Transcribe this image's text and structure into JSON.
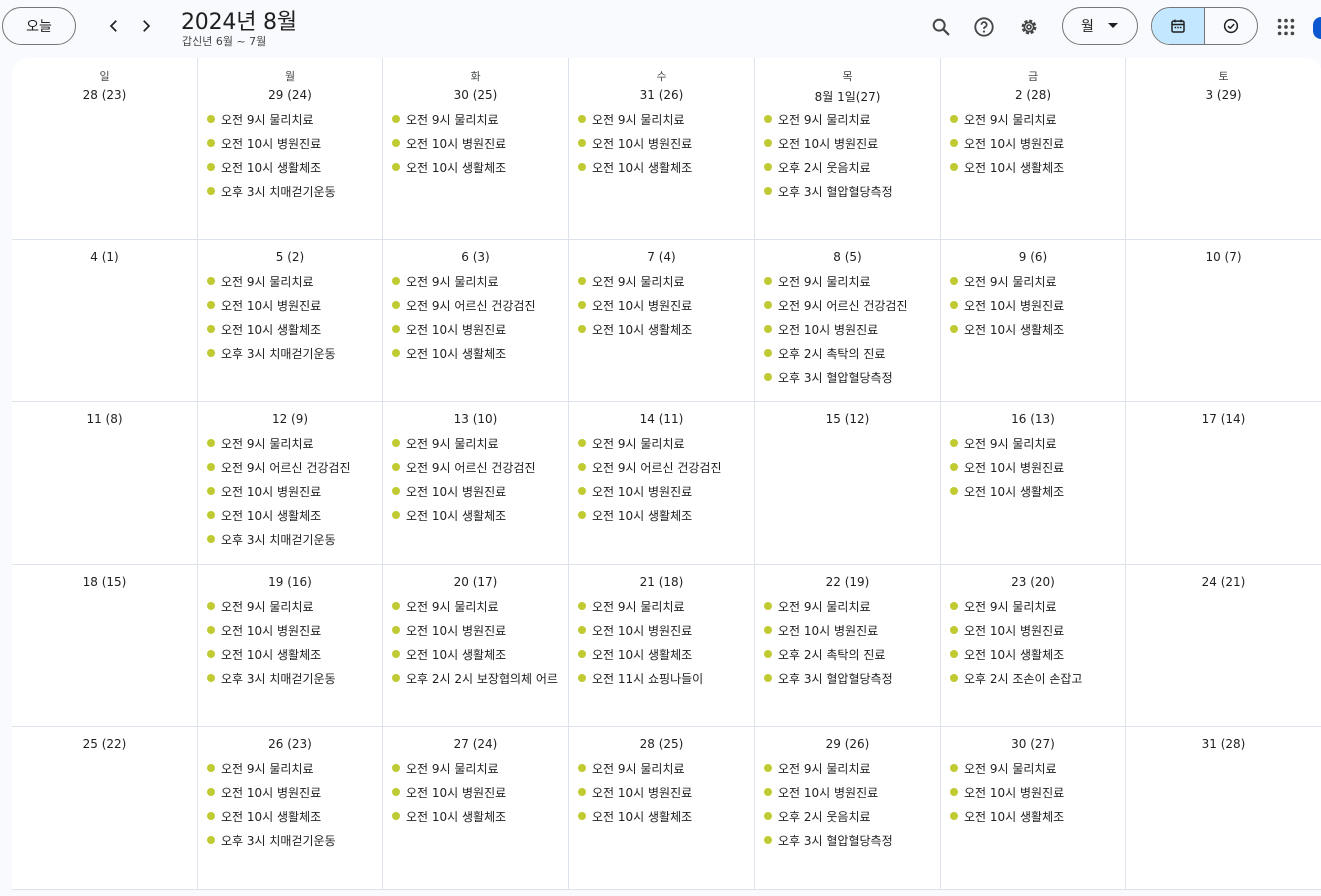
{
  "header": {
    "today_label": "오늘",
    "title": "2024년 8월",
    "subtitle": "갑신년 6월 ~ 7월",
    "view_label": "월",
    "icons": {
      "prev": "chevron-left-icon",
      "next": "chevron-right-icon",
      "search": "search-icon",
      "help": "help-icon",
      "settings": "gear-icon",
      "dropdown": "caret-down-icon",
      "calendar": "calendar-icon",
      "tasks": "task-check-icon",
      "apps": "apps-grid-icon"
    },
    "accent_color": "#c2e7ff",
    "event_dot_color": "#c0ca33"
  },
  "weekdays": [
    "일",
    "월",
    "화",
    "수",
    "목",
    "금",
    "토"
  ],
  "weeks": [
    [
      {
        "date": "28 (23)",
        "events": []
      },
      {
        "date": "29 (24)",
        "events": [
          "오전 9시 물리치료",
          "오전 10시 병원진료",
          "오전 10시 생활체조",
          "오후 3시 치매걷기운동"
        ]
      },
      {
        "date": "30 (25)",
        "events": [
          "오전 9시 물리치료",
          "오전 10시 병원진료",
          "오전 10시 생활체조"
        ]
      },
      {
        "date": "31 (26)",
        "events": [
          "오전 9시 물리치료",
          "오전 10시 병원진료",
          "오전 10시 생활체조"
        ]
      },
      {
        "date": "8월 1일(27)",
        "events": [
          "오전 9시 물리치료",
          "오전 10시 병원진료",
          "오후 2시 웃음치료",
          "오후 3시 혈압혈당측정"
        ]
      },
      {
        "date": "2 (28)",
        "events": [
          "오전 9시 물리치료",
          "오전 10시 병원진료",
          "오전 10시 생활체조"
        ]
      },
      {
        "date": "3 (29)",
        "events": []
      }
    ],
    [
      {
        "date": "4 (1)",
        "events": []
      },
      {
        "date": "5 (2)",
        "events": [
          "오전 9시 물리치료",
          "오전 10시 병원진료",
          "오전 10시 생활체조",
          "오후 3시 치매걷기운동"
        ]
      },
      {
        "date": "6 (3)",
        "events": [
          "오전 9시 물리치료",
          "오전 9시 어르신 건강검진",
          "오전 10시 병원진료",
          "오전 10시 생활체조"
        ]
      },
      {
        "date": "7 (4)",
        "events": [
          "오전 9시 물리치료",
          "오전 10시 병원진료",
          "오전 10시 생활체조"
        ]
      },
      {
        "date": "8 (5)",
        "events": [
          "오전 9시 물리치료",
          "오전 9시 어르신 건강검진",
          "오전 10시 병원진료",
          "오후 2시 촉탁의 진료",
          "오후 3시 혈압혈당측정"
        ]
      },
      {
        "date": "9 (6)",
        "events": [
          "오전 9시 물리치료",
          "오전 10시 병원진료",
          "오전 10시 생활체조"
        ]
      },
      {
        "date": "10 (7)",
        "events": []
      }
    ],
    [
      {
        "date": "11 (8)",
        "events": []
      },
      {
        "date": "12 (9)",
        "events": [
          "오전 9시 물리치료",
          "오전 9시 어르신 건강검진",
          "오전 10시 병원진료",
          "오전 10시 생활체조",
          "오후 3시 치매걷기운동"
        ]
      },
      {
        "date": "13 (10)",
        "events": [
          "오전 9시 물리치료",
          "오전 9시 어르신 건강검진",
          "오전 10시 병원진료",
          "오전 10시 생활체조"
        ]
      },
      {
        "date": "14 (11)",
        "events": [
          "오전 9시 물리치료",
          "오전 9시 어르신 건강검진",
          "오전 10시 병원진료",
          "오전 10시 생활체조"
        ]
      },
      {
        "date": "15 (12)",
        "events": []
      },
      {
        "date": "16 (13)",
        "events": [
          "오전 9시 물리치료",
          "오전 10시 병원진료",
          "오전 10시 생활체조"
        ]
      },
      {
        "date": "17 (14)",
        "events": []
      }
    ],
    [
      {
        "date": "18 (15)",
        "events": []
      },
      {
        "date": "19 (16)",
        "events": [
          "오전 9시 물리치료",
          "오전 10시 병원진료",
          "오전 10시 생활체조",
          "오후 3시 치매걷기운동"
        ]
      },
      {
        "date": "20 (17)",
        "events": [
          "오전 9시 물리치료",
          "오전 10시 병원진료",
          "오전 10시 생활체조",
          "오후 2시 2시 보장협의체 어르"
        ]
      },
      {
        "date": "21 (18)",
        "events": [
          "오전 9시 물리치료",
          "오전 10시 병원진료",
          "오전 10시 생활체조",
          "오전 11시 쇼핑나들이"
        ]
      },
      {
        "date": "22 (19)",
        "events": [
          "오전 9시 물리치료",
          "오전 10시 병원진료",
          "오후 2시 촉탁의 진료",
          "오후 3시 혈압혈당측정"
        ]
      },
      {
        "date": "23 (20)",
        "events": [
          "오전 9시 물리치료",
          "오전 10시 병원진료",
          "오전 10시 생활체조",
          "오후 2시 조손이 손잡고"
        ]
      },
      {
        "date": "24 (21)",
        "events": []
      }
    ],
    [
      {
        "date": "25 (22)",
        "events": []
      },
      {
        "date": "26 (23)",
        "events": [
          "오전 9시 물리치료",
          "오전 10시 병원진료",
          "오전 10시 생활체조",
          "오후 3시 치매걷기운동"
        ]
      },
      {
        "date": "27 (24)",
        "events": [
          "오전 9시 물리치료",
          "오전 10시 병원진료",
          "오전 10시 생활체조"
        ]
      },
      {
        "date": "28 (25)",
        "events": [
          "오전 9시 물리치료",
          "오전 10시 병원진료",
          "오전 10시 생활체조"
        ]
      },
      {
        "date": "29 (26)",
        "events": [
          "오전 9시 물리치료",
          "오전 10시 병원진료",
          "오후 2시 웃음치료",
          "오후 3시 혈압혈당측정"
        ]
      },
      {
        "date": "30 (27)",
        "events": [
          "오전 9시 물리치료",
          "오전 10시 병원진료",
          "오전 10시 생활체조"
        ]
      },
      {
        "date": "31 (28)",
        "events": []
      }
    ]
  ]
}
